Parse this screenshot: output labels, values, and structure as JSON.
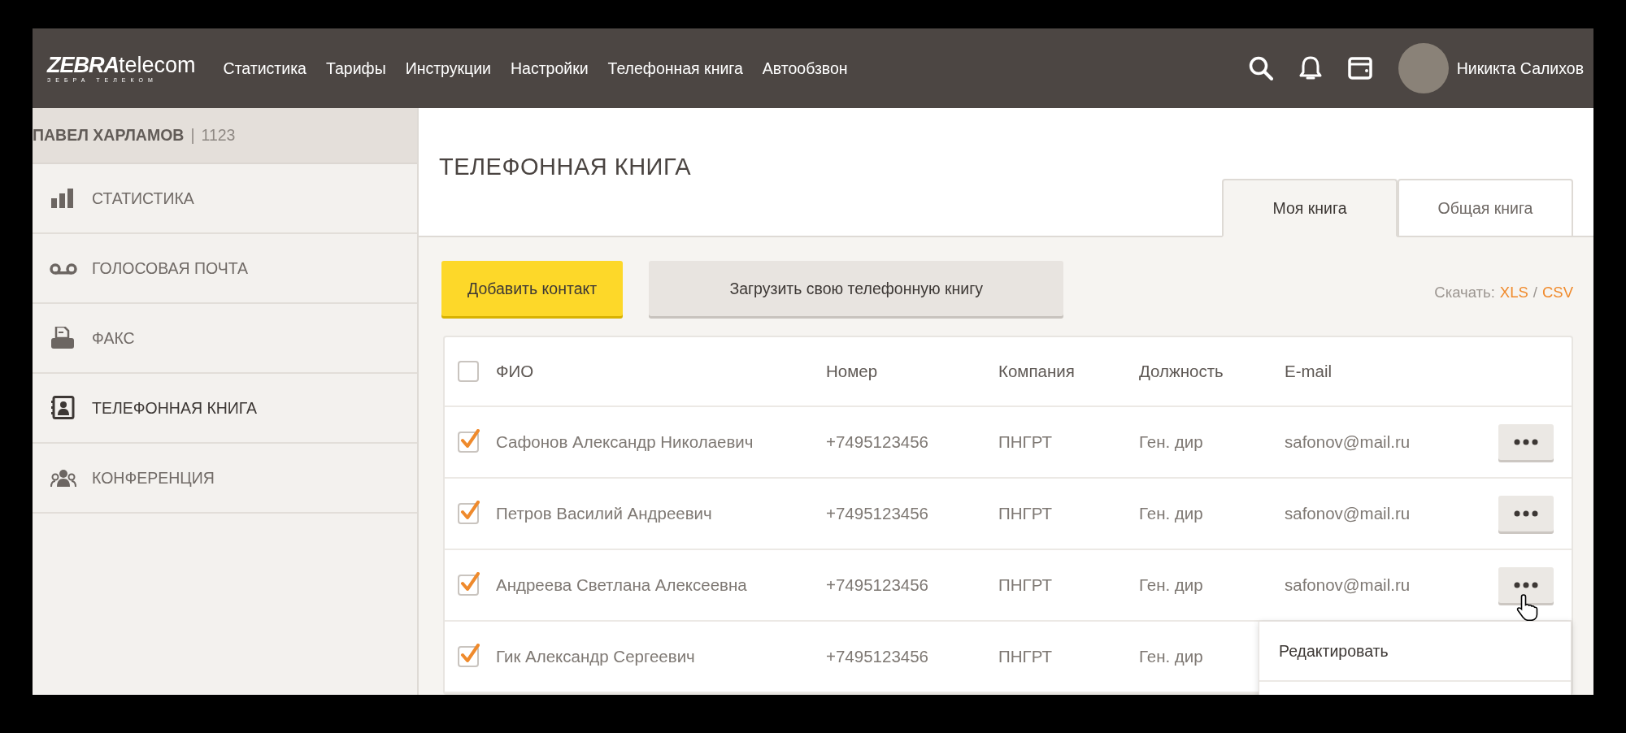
{
  "header": {
    "logo": {
      "brand": "ZEBRA",
      "suffix": "telecom",
      "subtitle": "ЗЕБРА ТЕЛЕКОМ"
    },
    "nav": [
      {
        "label": "Статистика"
      },
      {
        "label": "Тарифы"
      },
      {
        "label": "Инструкции"
      },
      {
        "label": "Настройки"
      },
      {
        "label": "Телефонная книга"
      },
      {
        "label": "Автообзвон"
      }
    ],
    "user": {
      "name": "Никикта Салихов"
    }
  },
  "sidebar": {
    "account": {
      "name": "ПАВЕЛ ХАРЛАМОВ",
      "separator": "|",
      "number": "1123"
    },
    "items": [
      {
        "label": "СТАТИСТИКА",
        "selected": false
      },
      {
        "label": "ГОЛОСОВАЯ ПОЧТА",
        "selected": false
      },
      {
        "label": "ФАКС",
        "selected": false
      },
      {
        "label": "ТЕЛЕФОННАЯ КНИГА",
        "selected": true
      },
      {
        "label": "КОНФЕРЕНЦИЯ",
        "selected": false
      }
    ]
  },
  "page": {
    "title": "ТЕЛЕФОННАЯ КНИГА",
    "tabs": [
      {
        "label": "Моя книга",
        "selected": true
      },
      {
        "label": "Общая книга",
        "selected": false
      }
    ],
    "buttons": [
      {
        "label": "Добавить контакт",
        "kind": "primary"
      },
      {
        "label": "Загрузить свою телефонную книгу",
        "kind": "secondary"
      }
    ],
    "download": {
      "label": "Скачать:",
      "links": [
        "XLS",
        "CSV"
      ],
      "separator": "/"
    }
  },
  "table": {
    "select_all": {
      "checked": false
    },
    "columns": [
      "ФИО",
      "Номер",
      "Компания",
      "Должность",
      "E-mail"
    ],
    "rows": [
      {
        "checked": true,
        "menu_open": false,
        "cells": [
          "Сафонов Александр Николаевич",
          "+7495123456",
          "ПНГРТ",
          "Ген. дир",
          "safonov@mail.ru"
        ]
      },
      {
        "checked": true,
        "menu_open": false,
        "cells": [
          "Петров Василий Андреевич",
          "+7495123456",
          "ПНГРТ",
          "Ген. дир",
          "safonov@mail.ru"
        ]
      },
      {
        "checked": true,
        "menu_open": true,
        "cells": [
          "Андреева Светлана Алексеевна",
          "+7495123456",
          "ПНГРТ",
          "Ген. дир",
          "safonov@mail.ru"
        ]
      },
      {
        "checked": true,
        "menu_open": false,
        "cells": [
          "Гик Александр Сергеевич",
          "+7495123456",
          "ПНГРТ",
          "Ген. дир"
        ]
      }
    ],
    "menu": {
      "items": [
        {
          "label": "Редактировать"
        }
      ]
    }
  }
}
